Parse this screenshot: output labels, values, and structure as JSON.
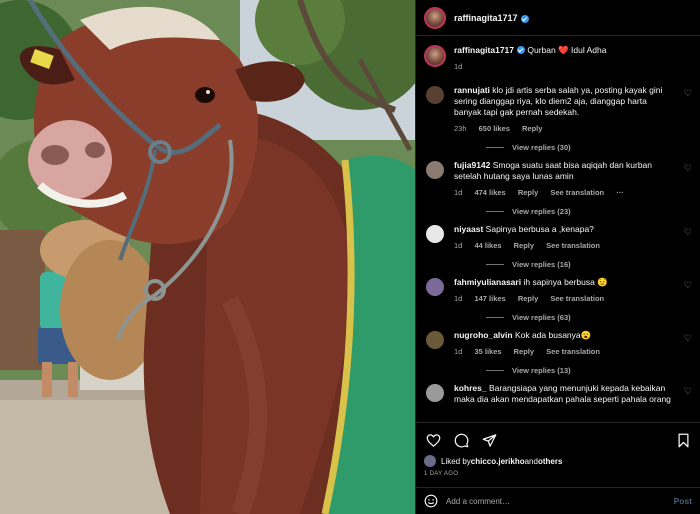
{
  "header": {
    "username": "raffinagita1717"
  },
  "caption": {
    "username": "raffinagita1717",
    "text": " Qurban ❤️ Idul Adha",
    "time": "1d"
  },
  "comments": [
    {
      "username": "rannujati",
      "text": "klo jdi artis serba salah ya, posting kayak gini sering dianggap riya, klo diem2 aja, dianggap harta banyak tapi gak pernah sedekah.",
      "time": "23h",
      "likes": "650 likes",
      "reply": "Reply",
      "translate": "",
      "view_replies": "View replies (30)",
      "avatar_color": "#5a4030"
    },
    {
      "username": "fujia9142",
      "text": "Smoga suatu saat bisa aqiqah dan kurban setelah hutang saya lunas amin",
      "time": "1d",
      "likes": "474 likes",
      "reply": "Reply",
      "translate": "See translation",
      "more": "···",
      "view_replies": "View replies (23)",
      "avatar_color": "#8a7a70"
    },
    {
      "username": "niyaast",
      "text": "Sapinya berbusa a ,kenapa?",
      "time": "1d",
      "likes": "44 likes",
      "reply": "Reply",
      "translate": "See translation",
      "view_replies": "View replies (16)",
      "avatar_color": "#e8e8e8"
    },
    {
      "username": "fahmiyulianasari",
      "text": "ih sapinya berbusa 😟",
      "time": "1d",
      "likes": "147 likes",
      "reply": "Reply",
      "translate": "See translation",
      "view_replies": "View replies (63)",
      "avatar_color": "#7a6a9a"
    },
    {
      "username": "nugroho_alvin",
      "text": "Kok ada busanya😮",
      "time": "1d",
      "likes": "35 likes",
      "reply": "Reply",
      "translate": "See translation",
      "view_replies": "View replies (13)",
      "avatar_color": "#6a5a3a"
    },
    {
      "username": "kohres_",
      "text": "Barangsiapa yang menunjuki kepada kebaikan maka dia akan mendapatkan pahala seperti pahala orang",
      "time": "",
      "likes": "",
      "reply": "",
      "translate": "",
      "view_replies": "",
      "avatar_color": "#9a9a9a"
    }
  ],
  "actions": {
    "heart_icon": "heart-icon",
    "comment_icon": "comment-icon",
    "share_icon": "share-icon",
    "save_icon": "bookmark-icon"
  },
  "likes": {
    "prefix": "Liked by ",
    "user": "chicco.jerikho",
    "middle": " and ",
    "others": "others"
  },
  "time_ago": "1 DAY AGO",
  "add_comment": {
    "placeholder": "Add a comment…",
    "post_label": "Post"
  },
  "colors": {
    "verified": "#3897f0",
    "post_button": "#4a5d7a",
    "meta_text": "#a8a8a8"
  }
}
